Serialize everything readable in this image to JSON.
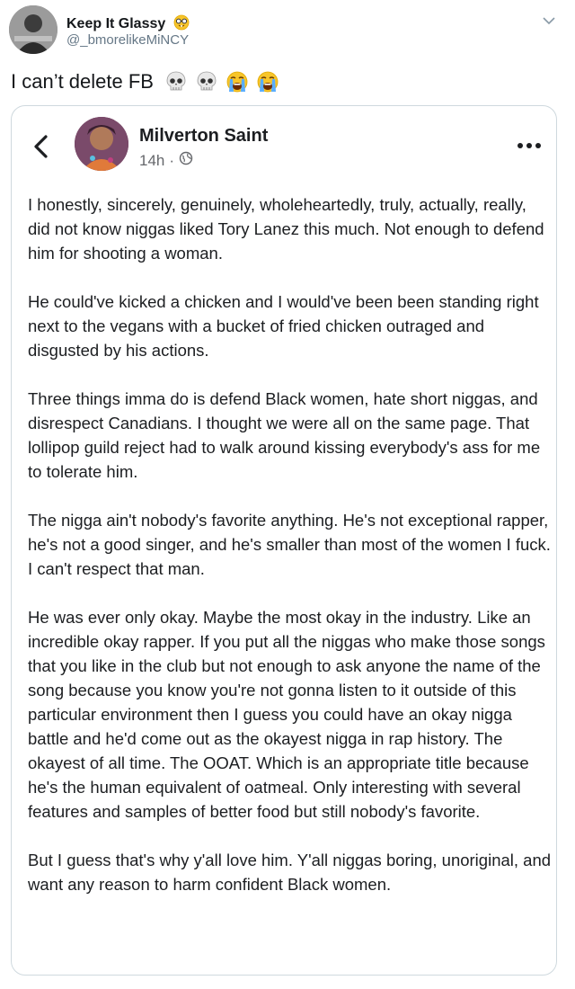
{
  "tweet": {
    "author_name": "Keep It Glassy",
    "author_handle": "@_bmorelikeMiNCY",
    "text": "I can’t delete FB",
    "emojis": [
      "skull-emoji",
      "skull-emoji",
      "loudly-crying-face-emoji",
      "loudly-crying-face-emoji"
    ],
    "name_emoji": "nerd-face-emoji"
  },
  "fb_post": {
    "author_name": "Milverton Saint",
    "time": "14h",
    "separator": "·",
    "privacy_icon": "globe-icon",
    "paragraphs": [
      "I honestly, sincerely, genuinely, wholeheartedly, truly, actually, really, did not know niggas liked Tory Lanez this much. Not enough to defend him for shooting a woman.",
      "He could've kicked a chicken and I would've been been standing right next to the vegans with a bucket of fried chicken outraged and disgusted by his actions.",
      "Three things imma do is defend Black women, hate short niggas, and disrespect Canadians. I thought we were all on the same page. That lollipop guild reject had to walk around kissing everybody's ass for me to tolerate him.",
      "The nigga ain't nobody's favorite anything. He's not exceptional rapper, he's not a good singer, and he's smaller than most of the women I fuck. I can't respect that man.",
      "He was ever only okay. Maybe the most okay in the industry. Like an incredible okay rapper. If you put all the niggas who make those songs that you like in the club but not enough to ask anyone the name of the song because you know you're not gonna listen to it outside of this particular environment then I guess you could have an okay nigga battle and he'd come out as the okayest nigga in rap history. The okayest of all time. The OOAT. Which is an appropriate title because he's the human equivalent of oatmeal. Only interesting with several features and samples of better food but still nobody's favorite.",
      "But I guess that's why y'all love him. Y'all niggas boring, unoriginal, and want any reason to harm confident Black women."
    ]
  },
  "colors": {
    "twitter_handle": "#657786",
    "fb_meta": "#65676b",
    "card_border": "#cfd9de"
  }
}
